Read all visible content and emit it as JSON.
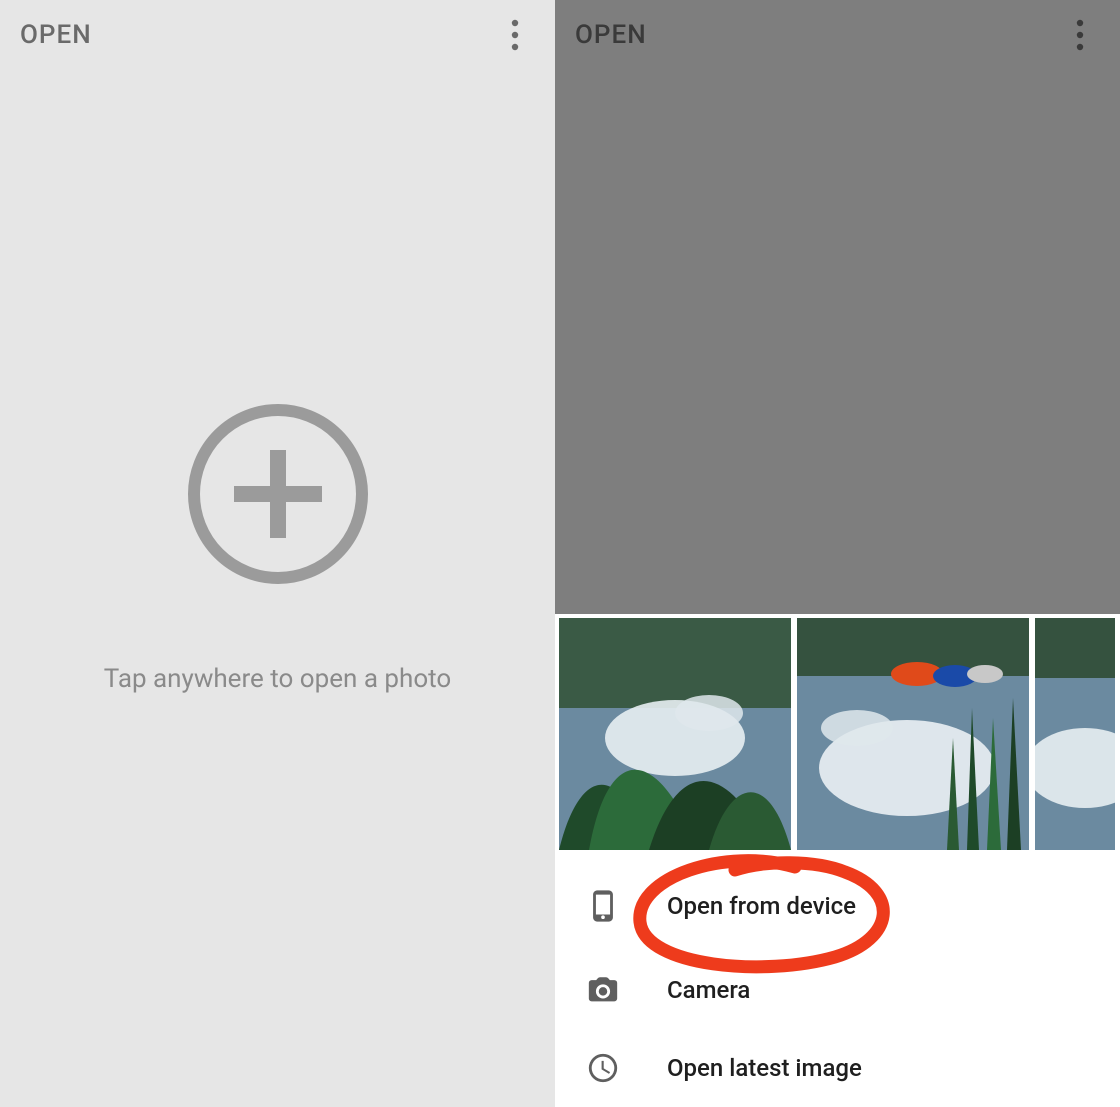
{
  "left": {
    "title": "OPEN",
    "hint": "Tap anywhere to open a photo"
  },
  "right": {
    "title": "OPEN",
    "sheet": {
      "thumbs": [
        {
          "alt": "pond-reflection-plants"
        },
        {
          "alt": "pond-reflection-boats"
        },
        {
          "alt": "photo-thumbnail"
        }
      ],
      "menu": {
        "open_from_device": "Open from device",
        "camera": "Camera",
        "open_latest": "Open latest image"
      }
    }
  },
  "annotation": {
    "highlight": "open-from-device"
  }
}
